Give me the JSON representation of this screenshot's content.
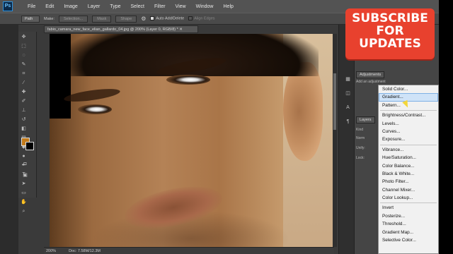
{
  "app": {
    "logo": "Ps"
  },
  "menu": [
    "File",
    "Edit",
    "Image",
    "Layer",
    "Type",
    "Select",
    "Filter",
    "View",
    "Window",
    "Help"
  ],
  "options": {
    "tool_mode": "Path",
    "make_label": "Make:",
    "buttons": [
      "Selection...",
      "Mask",
      "Shape"
    ],
    "auto_add_delete": "Auto Add/Delete",
    "align_edges": "Align Edges"
  },
  "document": {
    "tab_title": "fabio_camara_new_face_elian_gallardo_04.jpg @ 200% (Layer 0, RGB/8) *",
    "zoom": "200%",
    "doc_size": "Doc: 7.58M/12.3M"
  },
  "panels": {
    "adjustments_tab": "Adjustments",
    "add_adjustment": "Add an adjustment",
    "layers_tab": "Layers",
    "kind": "Kind",
    "normal": "Norm",
    "unify": "Unify:",
    "lock": "Lock:"
  },
  "badge": {
    "lines": [
      "SUBSCRIBE",
      "FOR",
      "UPDATES"
    ]
  },
  "dropdown": {
    "groups": [
      [
        "Solid Color...",
        "Gradient...",
        "Pattern..."
      ],
      [
        "Brightness/Contrast...",
        "Levels...",
        "Curves...",
        "Exposure..."
      ],
      [
        "Vibrance...",
        "Hue/Saturation...",
        "Color Balance...",
        "Black & White...",
        "Photo Filter...",
        "Channel Mixer...",
        "Color Lookup..."
      ],
      [
        "Invert",
        "Posterize...",
        "Threshold...",
        "Gradient Map...",
        "Selective Color..."
      ]
    ],
    "highlighted": "Gradient..."
  },
  "colors": {
    "foreground": "#c27a1a",
    "background": "#000000",
    "badge": "#e8412e"
  }
}
